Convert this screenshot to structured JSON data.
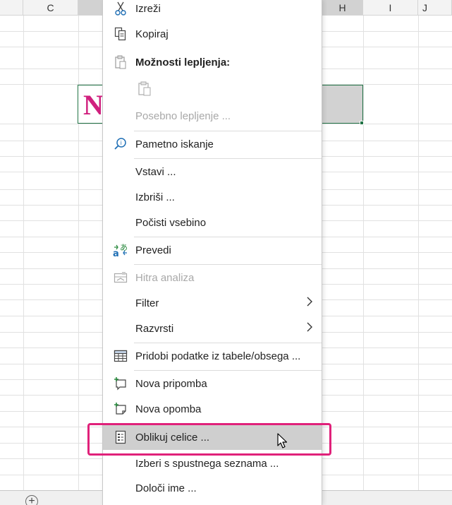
{
  "columns": {
    "c": "C",
    "h": "H",
    "i": "I",
    "j": "J"
  },
  "cell": {
    "text": "N"
  },
  "menu": {
    "cut": "Izreži",
    "copy": "Kopiraj",
    "paste_options": "Možnosti lepljenja:",
    "paste_special": "Posebno lepljenje ...",
    "smart_lookup": "Pametno iskanje",
    "insert": "Vstavi ...",
    "delete": "Izbriši ...",
    "clear_contents": "Počisti vsebino",
    "translate": "Prevedi",
    "quick_analysis": "Hitra analiza",
    "filter": "Filter",
    "sort": "Razvrsti",
    "get_data": "Pridobi podatke iz tabele/obsega ...",
    "new_comment": "Nova pripomba",
    "new_note": "Nova opomba",
    "format_cells": "Oblikuj celice ...",
    "pick_from_list": "Izberi s spustnega seznama ...",
    "define_name": "Določi ime ..."
  },
  "colors": {
    "accent_green": "#217346",
    "highlight": "#e0217a",
    "cell_text": "#d0207e"
  }
}
